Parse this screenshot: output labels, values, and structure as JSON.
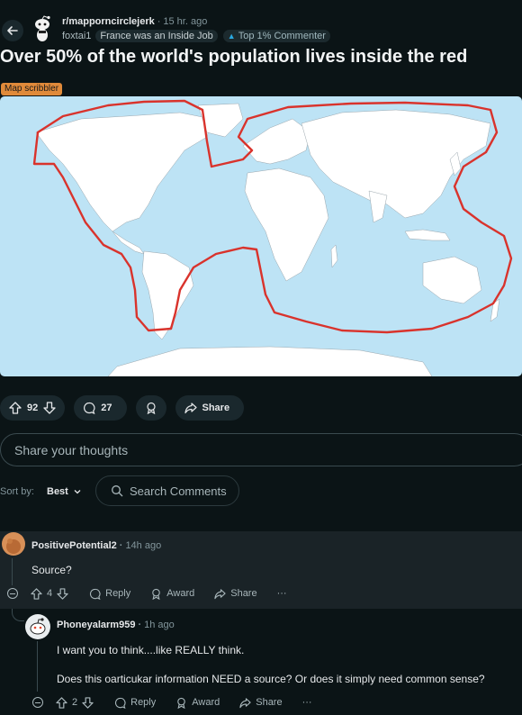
{
  "header": {
    "subreddit": "r/mapporncirclejerk",
    "time": "15 hr. ago",
    "author": "foxtai1",
    "author_flair": "France was an Inside Job",
    "badge": "Top 1% Commenter"
  },
  "post": {
    "title": "Over 50% of the world's population lives inside the red",
    "flair": "Map scribbler",
    "upvotes": "92",
    "comments": "27",
    "share_label": "Share"
  },
  "comment_box": {
    "placeholder": "Share your thoughts"
  },
  "sort": {
    "label": "Sort by:",
    "value": "Best",
    "search_placeholder": "Search Comments"
  },
  "comments": [
    {
      "author": "PositivePotential2",
      "time": "14h ago",
      "body": "Source?",
      "votes": "4",
      "reply": "Reply",
      "award": "Award",
      "share": "Share",
      "more": "···"
    },
    {
      "author": "Phoneyalarm959",
      "time": "1h ago",
      "body_lines": [
        "I want you to think....like REALLY think.",
        "Does this oarticukar information NEED a source? Or does it simply need common sense?"
      ],
      "votes": "2",
      "reply": "Reply",
      "award": "Award",
      "share": "Share",
      "more": "···"
    }
  ],
  "colors": {
    "background": "#0b1416",
    "ocean": "#bde3f5",
    "land": "#ffffff",
    "red_line": "#d9332c",
    "flair": "#e08a3a"
  }
}
